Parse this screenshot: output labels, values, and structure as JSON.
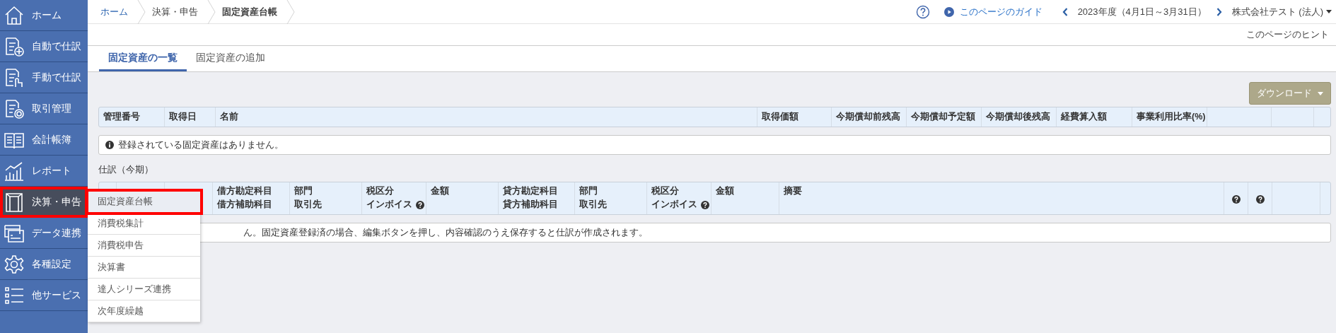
{
  "sidebar": {
    "items": [
      {
        "label": "ホーム",
        "selected": false,
        "highlighted": false
      },
      {
        "label": "自動で仕訳",
        "selected": false,
        "highlighted": false
      },
      {
        "label": "手動で仕訳",
        "selected": false,
        "highlighted": false
      },
      {
        "label": "取引管理",
        "selected": false,
        "highlighted": false
      },
      {
        "label": "会計帳簿",
        "selected": false,
        "highlighted": false
      },
      {
        "label": "レポート",
        "selected": false,
        "highlighted": false
      },
      {
        "label": "決算・申告",
        "selected": true,
        "highlighted": true
      },
      {
        "label": "データ連携",
        "selected": false,
        "highlighted": false
      },
      {
        "label": "各種設定",
        "selected": false,
        "highlighted": false
      },
      {
        "label": "他サービス",
        "selected": false,
        "highlighted": false
      }
    ]
  },
  "submenu": {
    "items": [
      {
        "label": "固定資産台帳",
        "selected": true,
        "highlighted": true
      },
      {
        "label": "消費税集計",
        "selected": false,
        "highlighted": false
      },
      {
        "label": "消費税申告",
        "selected": false,
        "highlighted": false
      },
      {
        "label": "決算書",
        "selected": false,
        "highlighted": false
      },
      {
        "label": "達人シリーズ連携",
        "selected": false,
        "highlighted": false
      },
      {
        "label": "次年度繰越",
        "selected": false,
        "highlighted": false
      }
    ]
  },
  "breadcrumbs": [
    {
      "label": "ホーム",
      "kind": "link"
    },
    {
      "label": "決算・申告",
      "kind": "plain"
    },
    {
      "label": "固定資産台帳",
      "kind": "current"
    }
  ],
  "header": {
    "guide_link": "このページのガイド",
    "fiscal_year": "2023年度（4月1日～3月31日）",
    "company": "株式会社テスト (法人)",
    "hint_link": "このページのヒント"
  },
  "tabs": [
    {
      "label": "固定資産の一覧",
      "selected": true
    },
    {
      "label": "固定資産の追加",
      "selected": false
    }
  ],
  "download_button": "ダウンロード",
  "assets_table": {
    "columns": [
      "管理番号",
      "取得日",
      "名前",
      "取得価額",
      "今期償却前残高",
      "今期償却予定額",
      "今期償却後残高",
      "経費算入額",
      "事業利用比率(%)",
      "",
      "",
      ""
    ],
    "empty_message": "登録されている固定資産はありません。"
  },
  "journal_section": {
    "title": "仕訳（今期）"
  },
  "journal_table": {
    "columns": [
      {},
      {},
      {},
      {
        "lines": [
          "借方勘定科目",
          "借方補助科目"
        ]
      },
      {
        "lines": [
          "部門",
          "取引先"
        ]
      },
      {
        "lines": [
          "税区分",
          "インボイス"
        ],
        "help": true
      },
      {
        "lines": [
          "金額"
        ]
      },
      {
        "lines": [
          "貸方勘定科目",
          "貸方補助科目"
        ]
      },
      {
        "lines": [
          "部門",
          "取引先"
        ]
      },
      {
        "lines": [
          "税区分",
          "インボイス"
        ],
        "help": true
      },
      {
        "lines": [
          "金額"
        ]
      },
      {
        "lines": [
          "摘要"
        ]
      },
      {
        "help": true
      },
      {
        "help": true
      },
      {},
      {}
    ],
    "empty_message": "ん。固定資産登録済の場合、編集ボタンを押し、内容確認のうえ保存すると仕訳が作成されます。"
  }
}
